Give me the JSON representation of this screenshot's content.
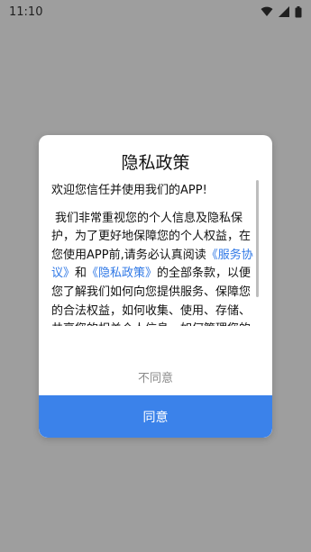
{
  "status": {
    "time": "11:10"
  },
  "dialog": {
    "title": "隐私政策",
    "welcome": "欢迎您信任并使用我们的APP!",
    "policy_part1": "我们非常重视您的个人信息及隐私保护，为了更好地保障您的个人权益，在您使用APP前,请务必认真阅读",
    "link_service": "《服务协议》",
    "policy_and": "和",
    "link_privacy": "《隐私政策》",
    "policy_part2": "的全部条款，以便您了解我们如何向您提供服务、保障您的合法权益，如何收集、使用、存储、共享您的相关个人信息，如何管理您的相关个人信息，以及我们对您提供",
    "disagree_label": "不同意",
    "agree_label": "同意"
  },
  "colors": {
    "overlay": "#9e9e9e",
    "link": "#2f78e6",
    "agree_button": "#3b82ea"
  }
}
